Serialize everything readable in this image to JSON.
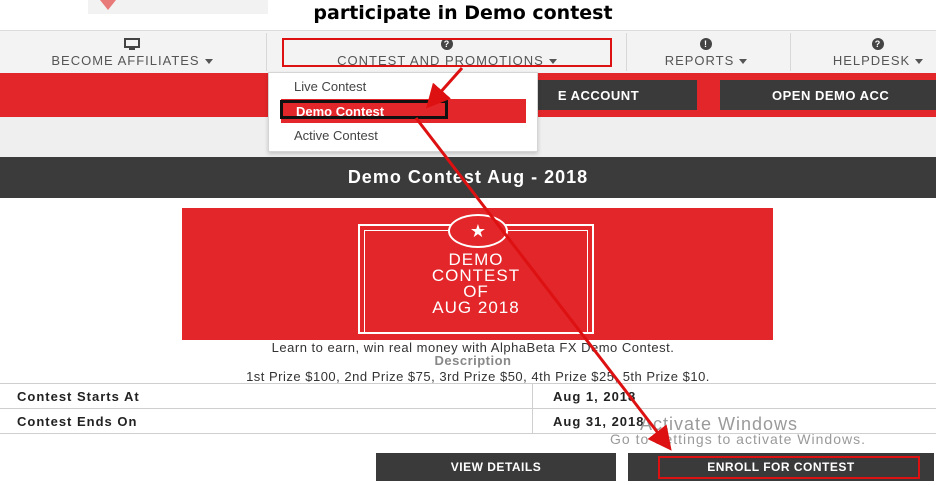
{
  "caption": "participate in Demo contest",
  "nav": {
    "affiliates": "BECOME AFFILIATES",
    "contest": "CONTEST AND PROMOTIONS",
    "reports": "REPORTS",
    "helpdesk": "HELPDESK"
  },
  "band_buttons": {
    "live_account": "E ACCOUNT",
    "demo_account": "OPEN DEMO ACC"
  },
  "dropdown": {
    "items": [
      "Live Contest",
      "Demo Contest",
      "Active Contest"
    ],
    "selected": "Demo Contest"
  },
  "contest": {
    "title": "Demo Contest Aug - 2018",
    "banner_lines": [
      "DEMO",
      "CONTEST",
      "OF",
      "AUG 2018"
    ],
    "tagline": "Learn to earn, win real money with AlphaBeta FX Demo Contest.",
    "description_heading": "Description",
    "prizes": "1st Prize $100, 2nd Prize $75, 3rd Prize $50, 4th Prize $25, 5th Prize $10.",
    "rows": [
      {
        "label": "Contest Starts At",
        "value": "Aug 1, 2018"
      },
      {
        "label": "Contest Ends On",
        "value": "Aug 31, 2018"
      }
    ],
    "view_details": "VIEW DETAILS",
    "enroll": "ENROLL FOR CONTEST"
  },
  "watermark": {
    "line1": "Activate Windows",
    "line2": "Go to Settings to activate Windows."
  },
  "colors": {
    "accent": "#e3262a",
    "dark": "#3a3a3a",
    "annotation": "#dd1111"
  }
}
